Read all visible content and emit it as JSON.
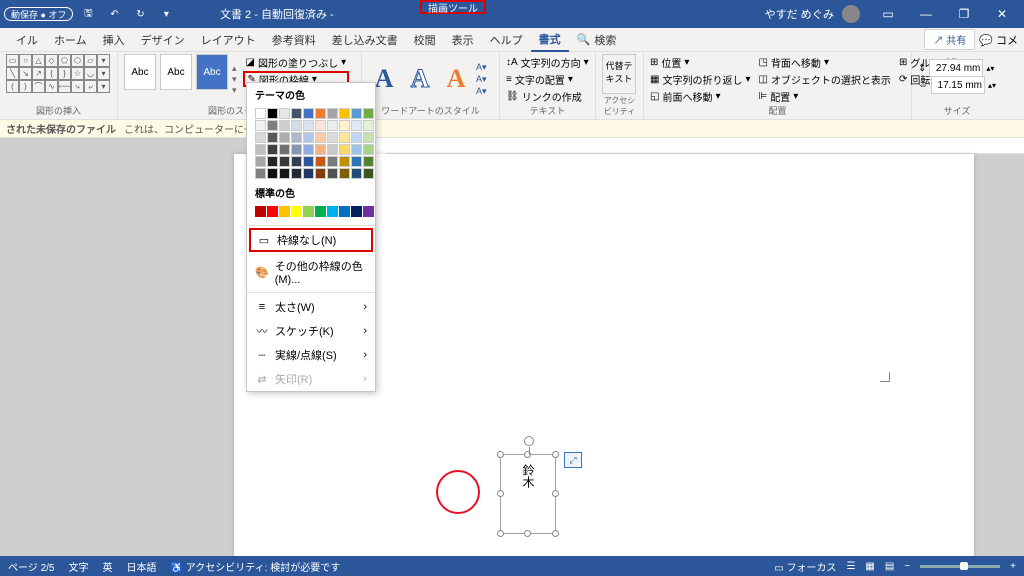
{
  "titlebar": {
    "autosave": "動保存 ● オフ",
    "doc": "文書 2 - 自動回復済み -",
    "tool_tab": "描画ツール",
    "user": "やすだ めぐみ"
  },
  "tabs": {
    "items": [
      "イル",
      "ホーム",
      "挿入",
      "デザイン",
      "レイアウト",
      "参考資料",
      "差し込み文書",
      "校閲",
      "表示",
      "ヘルプ",
      "書式"
    ],
    "active_index": 10,
    "search": "検索",
    "share": "共有",
    "comment": "コメ"
  },
  "ribbon": {
    "shapes_label": "図形の挿入",
    "styles_label": "図形のスタイル",
    "style_text": "Abc",
    "fill": "図形の塗りつぶし",
    "outline": "図形の枠線",
    "wa_label": "ワードアートのスタイル",
    "text_label": "テキスト",
    "link_create": "リンクの作成",
    "text_dir": "文字列の方向",
    "text_align": "文字の配置",
    "alt": "代替テキスト",
    "acc_label": "アクセシビリティ",
    "arr_label": "配置",
    "pos": "位置",
    "wrap": "文字列の折り返し",
    "fwd": "前面へ移動",
    "back": "背面へ移動",
    "sel": "オブジェクトの選択と表示",
    "align": "配置",
    "group": "グループ化",
    "rotate": "回転",
    "size_label": "サイズ",
    "size_h": "27.94 mm",
    "size_w": "17.15 mm"
  },
  "dropdown": {
    "theme": "テーマの色",
    "standard": "標準の色",
    "no_outline": "枠線なし(N)",
    "more": "その他の枠線の色(M)...",
    "weight": "太さ(W)",
    "sketch": "スケッチ(K)",
    "dashes": "実線/点線(S)",
    "arrows": "矢印(R)",
    "std_colors": [
      "#c00000",
      "#ff0000",
      "#ffc000",
      "#ffff00",
      "#92d050",
      "#00b050",
      "#00b0f0",
      "#0070c0",
      "#002060",
      "#7030a0"
    ]
  },
  "infobar": {
    "label": "された未保存のファイル",
    "msg": "これは、コンピューターに一時的に保存されている"
  },
  "page": {
    "vtext": "鈴木"
  },
  "status": {
    "page": "ページ",
    "pages": "2/5",
    "words": "文字",
    "lang_ic": "英",
    "lang": "日本語",
    "acc": "アクセシビリティ: 検討が必要です",
    "focus": "フォーカス"
  }
}
